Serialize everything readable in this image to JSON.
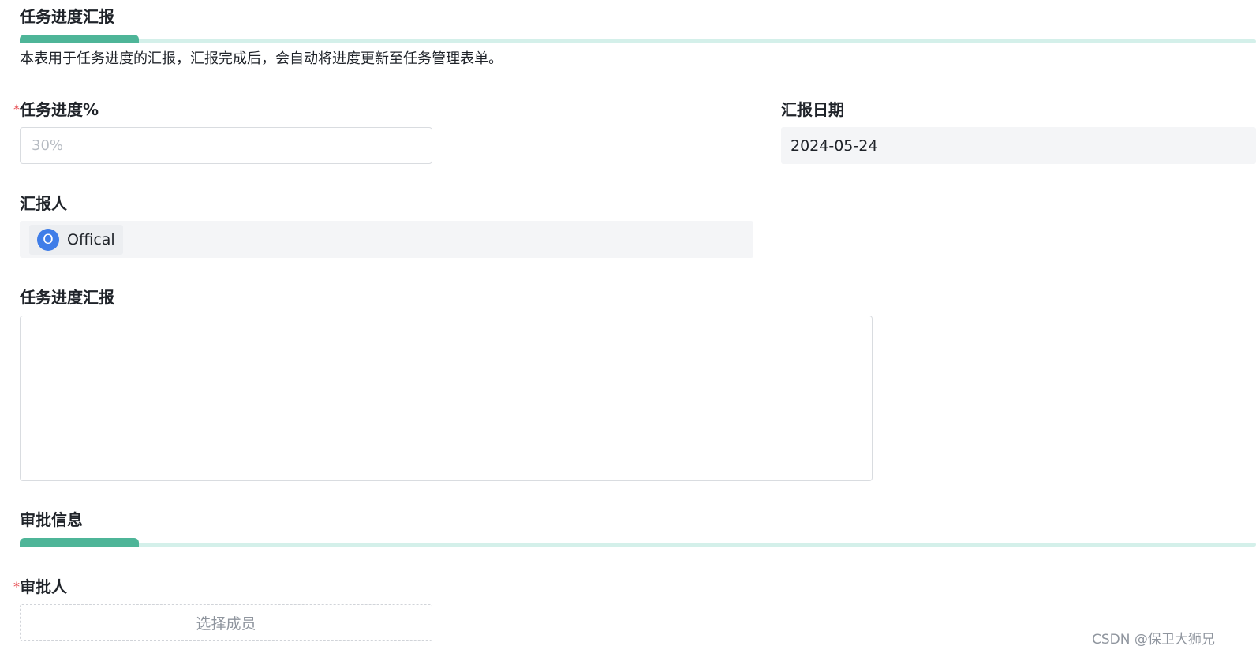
{
  "sections": {
    "progress": {
      "title": "任务进度汇报",
      "description": "本表用于任务进度的汇报，汇报完成后，会自动将进度更新至任务管理表单。"
    },
    "approval": {
      "title": "审批信息"
    }
  },
  "fields": {
    "progress_percent": {
      "label": "任务进度%",
      "required_mark": "*",
      "placeholder": "30%"
    },
    "report_date": {
      "label": "汇报日期",
      "value": "2024-05-24"
    },
    "reporter": {
      "label": "汇报人",
      "user_initial": "O",
      "user_name": "Offical"
    },
    "report_text": {
      "label": "任务进度汇报"
    },
    "approver": {
      "label": "审批人",
      "required_mark": "*",
      "button_label": "选择成员"
    }
  },
  "watermark": "CSDN @保卫大狮兄",
  "colors": {
    "accent": "#4eb598",
    "accent_track": "#d4f0ea",
    "avatar": "#3f7de8",
    "required": "#e5484d"
  }
}
